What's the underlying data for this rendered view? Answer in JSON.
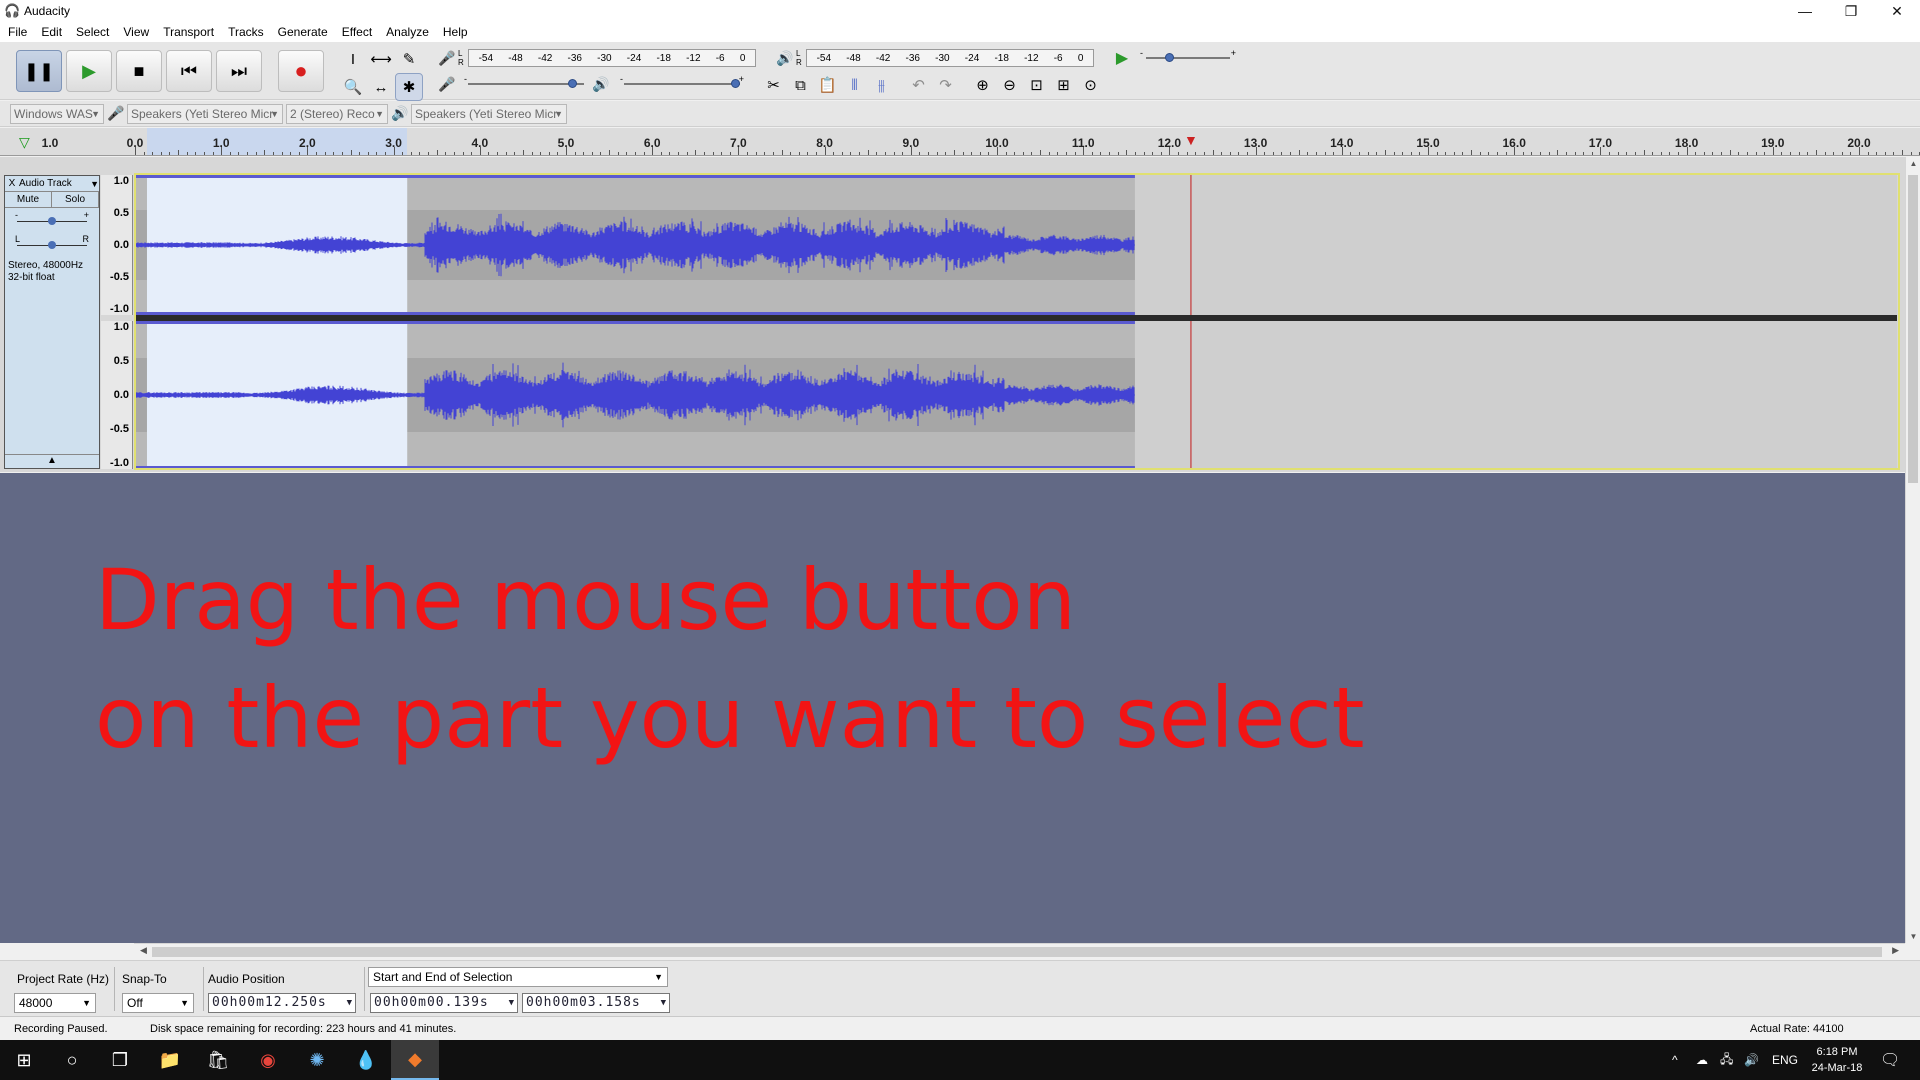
{
  "window": {
    "title": "Audacity",
    "controls": {
      "minimize": "—",
      "restore": "❐",
      "close": "✕"
    }
  },
  "menu": [
    "File",
    "Edit",
    "Select",
    "View",
    "Transport",
    "Tracks",
    "Generate",
    "Effect",
    "Analyze",
    "Help"
  ],
  "transport": {
    "pause": "❚❚",
    "play": "▶",
    "stop": "■",
    "skip_start": "⏮",
    "skip_end": "⏭",
    "record": "●"
  },
  "tools": {
    "selection": "I",
    "envelope": "⟷",
    "draw": "✎",
    "zoom": "🔍",
    "timeshift": "↔",
    "multi": "✱"
  },
  "meters": {
    "record_scale": [
      "-54",
      "-48",
      "-42",
      "-36",
      "-30",
      "-24",
      "-18",
      "-12",
      "-6",
      "0"
    ],
    "playback_scale": [
      "-54",
      "-48",
      "-42",
      "-36",
      "-30",
      "-24",
      "-18",
      "-12",
      "-6",
      "0"
    ],
    "lr": "L R"
  },
  "mixer": {
    "record_volume": 0.93,
    "playback_volume": 1.0,
    "play_speed": 0.25,
    "minus": "-",
    "plus": "+"
  },
  "edit_tools": [
    "✂",
    "⧉",
    "📋",
    "⫴",
    "⫵",
    "↶",
    "↷",
    "⊕",
    "⊖",
    "⊡",
    "⊞",
    "⊙"
  ],
  "devices": {
    "host": "Windows WAS",
    "recording_device": "Speakers (Yeti Stereo Micr",
    "channels": "2 (Stereo) Reco",
    "playback_device": "Speakers (Yeti Stereo Micr"
  },
  "ruler": {
    "start_label": "1.0",
    "ticks": [
      "0.0",
      "1.0",
      "2.0",
      "3.0",
      "4.0",
      "5.0",
      "6.0",
      "7.0",
      "8.0",
      "9.0",
      "10.0",
      "11.0",
      "12.0",
      "13.0",
      "14.0",
      "15.0",
      "16.0",
      "17.0",
      "18.0",
      "19.0",
      "20.0"
    ],
    "selection_start_sec": 0.139,
    "selection_end_sec": 3.158,
    "playhead_sec": 12.25
  },
  "track": {
    "name": "Audio Track",
    "close": "X",
    "mute": "Mute",
    "solo": "Solo",
    "gain_minus": "-",
    "gain_plus": "+",
    "pan_left": "L",
    "pan_right": "R",
    "format_line1": "Stereo, 48000Hz",
    "format_line2": "32-bit float",
    "collapse": "▲",
    "vruler_ticks": [
      "1.0",
      "0.5",
      "0.0",
      "-0.5",
      "-1.0"
    ],
    "clip_end_sec": 11.6,
    "colors": {
      "wave": "#4343d4",
      "clip_bg": "#b8b8b8",
      "selection_bg": "#e6eefa",
      "playhead": "#c41b1b"
    }
  },
  "instruction": {
    "line1": "Drag the mouse button",
    "line2": "on the part you want to select",
    "color": "#f21414"
  },
  "selection_toolbar": {
    "project_rate_label": "Project Rate (Hz)",
    "project_rate": "48000",
    "snap_to_label": "Snap-To",
    "snap_to": "Off",
    "audio_position_label": "Audio Position",
    "audio_position": "00h00m12.250s",
    "selection_mode": "Start and End of Selection",
    "selection_start": "00h00m00.139s",
    "selection_end": "00h00m03.158s"
  },
  "status": {
    "state": "Recording Paused.",
    "disk": "Disk space remaining for recording: 223 hours and 41 minutes.",
    "actual_rate": "Actual Rate: 44100"
  },
  "taskbar": {
    "start": "⊞",
    "search": "○",
    "task_view": "❐",
    "apps": [
      "📁",
      "🛍",
      "◉",
      "✺",
      "💧",
      "◆"
    ],
    "tray_up": "^",
    "tray_icons": [
      "☁",
      "🖧",
      "🔊"
    ],
    "language": "ENG",
    "time": "6:18 PM",
    "date": "24-Mar-18",
    "notification": "🗨"
  }
}
